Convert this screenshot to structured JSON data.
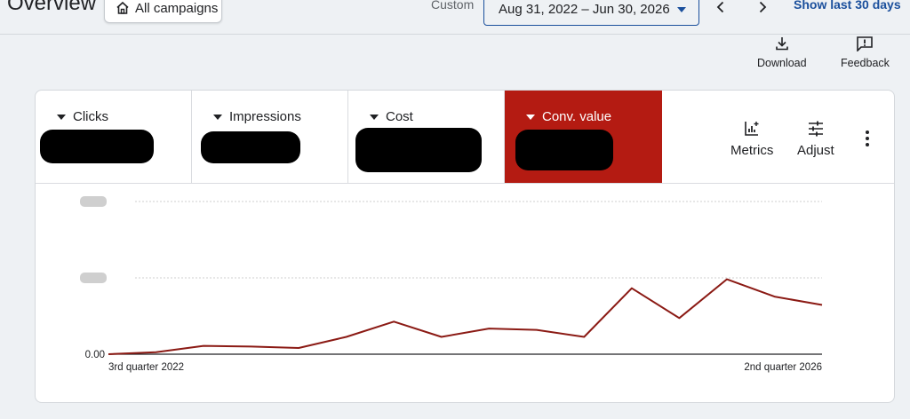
{
  "header": {
    "title": "Overview",
    "campaign_chip": "All campaigns",
    "custom_label": "Custom",
    "date_range": "Aug 31, 2022 – Jun 30, 2026",
    "show_last": "Show last 30 days"
  },
  "toolbar": {
    "download_label": "Download",
    "feedback_label": "Feedback"
  },
  "metric_tiles": [
    {
      "label": "Clicks",
      "active": false
    },
    {
      "label": "Impressions",
      "active": false
    },
    {
      "label": "Cost",
      "active": false
    },
    {
      "label": "Conv. value",
      "active": true
    }
  ],
  "tile_tools": {
    "metrics_label": "Metrics",
    "adjust_label": "Adjust"
  },
  "colors": {
    "accent": "#1a4f9c",
    "active_tile": "#b41b12",
    "series_line": "#8b1a14"
  },
  "chart_data": {
    "type": "line",
    "x_start_label": "3rd quarter 2022",
    "x_end_label": "2nd quarter 2026",
    "y_zero_label": "0.00",
    "grid": true,
    "values": [
      0,
      0.03,
      0.12,
      0.11,
      0.09,
      0.25,
      0.47,
      0.25,
      0.37,
      0.35,
      0.25,
      0.95,
      0.52,
      1.08,
      0.83,
      0.71
    ],
    "ylim": [
      0,
      2.2
    ]
  }
}
